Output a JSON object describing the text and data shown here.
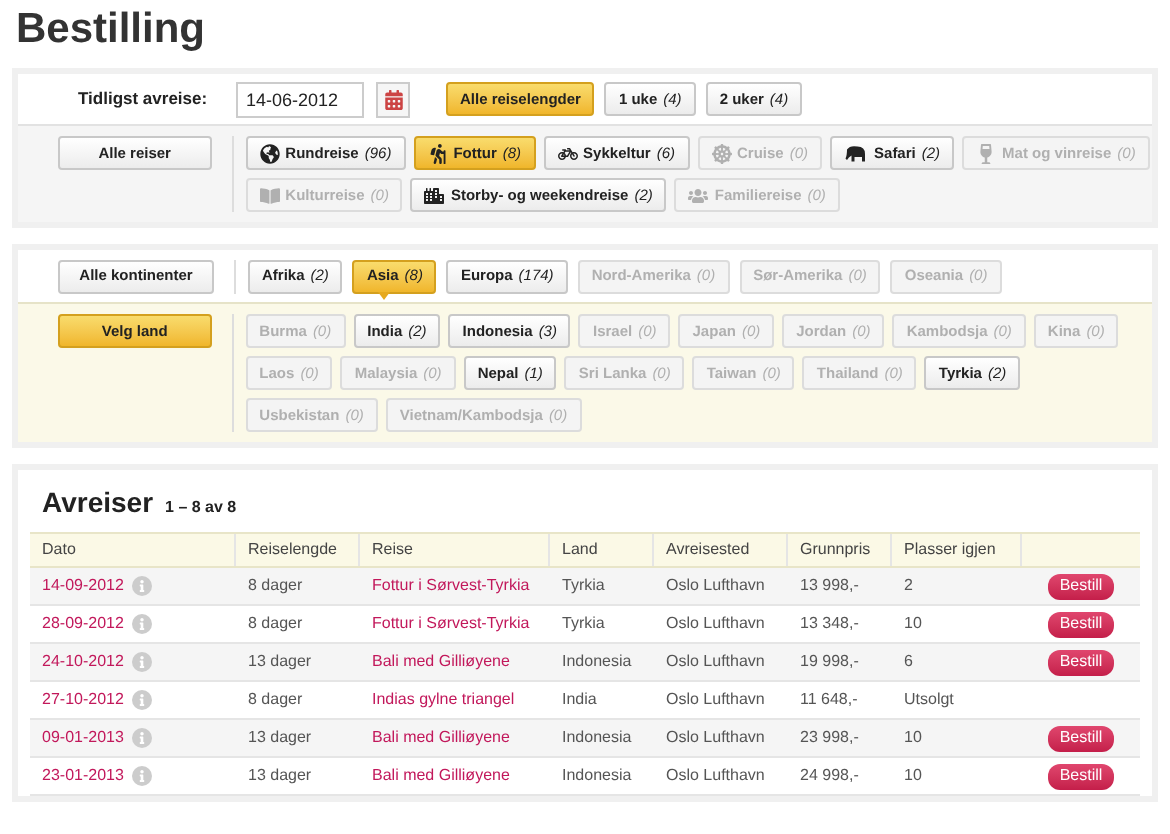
{
  "title": "Bestilling",
  "departure_filter": {
    "label": "Tidligst avreise:",
    "date": "14-06-2012"
  },
  "durations": [
    {
      "label": "Alle reiselengder",
      "selected": true
    },
    {
      "label": "1 uke",
      "count": "(4)",
      "selected": false
    },
    {
      "label": "2 uker",
      "count": "(4)",
      "selected": false
    }
  ],
  "trip_types_all": {
    "label": "Alle reiser",
    "selected": false
  },
  "trip_types": [
    {
      "label": "Rundreise",
      "count": "(96)",
      "selected": false,
      "disabled": false
    },
    {
      "label": "Fottur",
      "count": "(8)",
      "selected": true,
      "disabled": false
    },
    {
      "label": "Sykkeltur",
      "count": "(6)",
      "selected": false,
      "disabled": false
    },
    {
      "label": "Cruise",
      "count": "(0)",
      "selected": false,
      "disabled": true
    },
    {
      "label": "Safari",
      "count": "(2)",
      "selected": false,
      "disabled": false
    },
    {
      "label": "Mat og vinreise",
      "count": "(0)",
      "selected": false,
      "disabled": true
    },
    {
      "label": "Kulturreise",
      "count": "(0)",
      "selected": false,
      "disabled": true
    },
    {
      "label": "Storby- og weekendreise",
      "count": "(2)",
      "selected": false,
      "disabled": false
    },
    {
      "label": "Familiereise",
      "count": "(0)",
      "selected": false,
      "disabled": true
    }
  ],
  "continents_all": {
    "label": "Alle kontinenter",
    "selected": false
  },
  "continents": [
    {
      "label": "Afrika",
      "count": "(2)",
      "selected": false,
      "disabled": false
    },
    {
      "label": "Asia",
      "count": "(8)",
      "selected": true,
      "disabled": false
    },
    {
      "label": "Europa",
      "count": "(174)",
      "selected": false,
      "disabled": false
    },
    {
      "label": "Nord-Amerika",
      "count": "(0)",
      "selected": false,
      "disabled": true
    },
    {
      "label": "Sør-Amerika",
      "count": "(0)",
      "selected": false,
      "disabled": true
    },
    {
      "label": "Oseania",
      "count": "(0)",
      "selected": false,
      "disabled": true
    }
  ],
  "countries_all": {
    "label": "Velg land",
    "selected": true
  },
  "countries": [
    {
      "label": "Burma",
      "count": "(0)",
      "selected": false,
      "disabled": true
    },
    {
      "label": "India",
      "count": "(2)",
      "selected": false,
      "disabled": false
    },
    {
      "label": "Indonesia",
      "count": "(3)",
      "selected": false,
      "disabled": false
    },
    {
      "label": "Israel",
      "count": "(0)",
      "selected": false,
      "disabled": true
    },
    {
      "label": "Japan",
      "count": "(0)",
      "selected": false,
      "disabled": true
    },
    {
      "label": "Jordan",
      "count": "(0)",
      "selected": false,
      "disabled": true
    },
    {
      "label": "Kambodsja",
      "count": "(0)",
      "selected": false,
      "disabled": true
    },
    {
      "label": "Kina",
      "count": "(0)",
      "selected": false,
      "disabled": true
    },
    {
      "label": "Laos",
      "count": "(0)",
      "selected": false,
      "disabled": true
    },
    {
      "label": "Malaysia",
      "count": "(0)",
      "selected": false,
      "disabled": true
    },
    {
      "label": "Nepal",
      "count": "(1)",
      "selected": false,
      "disabled": false
    },
    {
      "label": "Sri Lanka",
      "count": "(0)",
      "selected": false,
      "disabled": true
    },
    {
      "label": "Taiwan",
      "count": "(0)",
      "selected": false,
      "disabled": true
    },
    {
      "label": "Thailand",
      "count": "(0)",
      "selected": false,
      "disabled": true
    },
    {
      "label": "Tyrkia",
      "count": "(2)",
      "selected": false,
      "disabled": false
    },
    {
      "label": "Usbekistan",
      "count": "(0)",
      "selected": false,
      "disabled": true
    },
    {
      "label": "Vietnam/Kambodsja",
      "count": "(0)",
      "selected": false,
      "disabled": true
    }
  ],
  "departures": {
    "title": "Avreiser",
    "range": "1 – 8 av 8",
    "columns": [
      "Dato",
      "Reiselengde",
      "Reise",
      "Land",
      "Avreisested",
      "Grunnpris",
      "Plasser igjen"
    ],
    "rows": [
      {
        "date": "14-09-2012",
        "length": "8 dager",
        "trip": "Fottur i Sørvest-Tyrkia",
        "country": "Tyrkia",
        "from": "Oslo Lufthavn",
        "price": "13 998,-",
        "seats": "2",
        "book": "Bestill"
      },
      {
        "date": "28-09-2012",
        "length": "8 dager",
        "trip": "Fottur i Sørvest-Tyrkia",
        "country": "Tyrkia",
        "from": "Oslo Lufthavn",
        "price": "13 348,-",
        "seats": "10",
        "book": "Bestill"
      },
      {
        "date": "24-10-2012",
        "length": "13 dager",
        "trip": "Bali med Gilliøyene",
        "country": "Indonesia",
        "from": "Oslo Lufthavn",
        "price": "19 998,-",
        "seats": "6",
        "book": "Bestill"
      },
      {
        "date": "27-10-2012",
        "length": "8 dager",
        "trip": "Indias gylne triangel",
        "country": "India",
        "from": "Oslo Lufthavn",
        "price": "11 648,-",
        "seats": "Utsolgt"
      },
      {
        "date": "09-01-2013",
        "length": "13 dager",
        "trip": "Bali med Gilliøyene",
        "country": "Indonesia",
        "from": "Oslo Lufthavn",
        "price": "23 998,-",
        "seats": "10",
        "book": "Bestill"
      },
      {
        "date": "23-01-2013",
        "length": "13 dager",
        "trip": "Bali med Gilliøyene",
        "country": "Indonesia",
        "from": "Oslo Lufthavn",
        "price": "24 998,-",
        "seats": "10",
        "book": "Bestill"
      }
    ]
  }
}
